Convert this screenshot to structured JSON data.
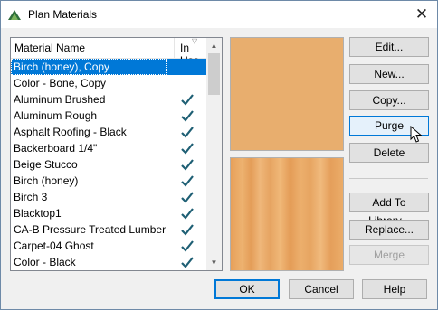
{
  "window": {
    "title": "Plan Materials",
    "close_glyph": "✕"
  },
  "list": {
    "header_name": "Material Name",
    "header_in_use": "In Use",
    "rows": [
      {
        "name": "Birch (honey), Copy",
        "in_use": false,
        "selected": true
      },
      {
        "name": "Color - Bone, Copy",
        "in_use": false
      },
      {
        "name": "Aluminum Brushed",
        "in_use": true
      },
      {
        "name": "Aluminum Rough",
        "in_use": true
      },
      {
        "name": "Asphalt Roofing - Black",
        "in_use": true
      },
      {
        "name": "Backerboard 1/4\"",
        "in_use": true
      },
      {
        "name": "Beige Stucco",
        "in_use": true
      },
      {
        "name": "Birch (honey)",
        "in_use": true
      },
      {
        "name": "Birch 3",
        "in_use": true
      },
      {
        "name": "Blacktop1",
        "in_use": true
      },
      {
        "name": "CA-B Pressure Treated Lumber",
        "in_use": true
      },
      {
        "name": "Carpet-04 Ghost",
        "in_use": true
      },
      {
        "name": "Color - Black",
        "in_use": true
      }
    ]
  },
  "buttons": {
    "edit": "Edit...",
    "new": "New...",
    "copy": "Copy...",
    "purge": "Purge",
    "delete": "Delete",
    "add_to_library": "Add To Library...",
    "replace": "Replace...",
    "merge": "Merge",
    "ok": "OK",
    "cancel": "Cancel",
    "help": "Help"
  },
  "colors": {
    "selection": "#0078d7",
    "check": "#1e5f74",
    "swatch_flat": "#e8ae6e"
  }
}
